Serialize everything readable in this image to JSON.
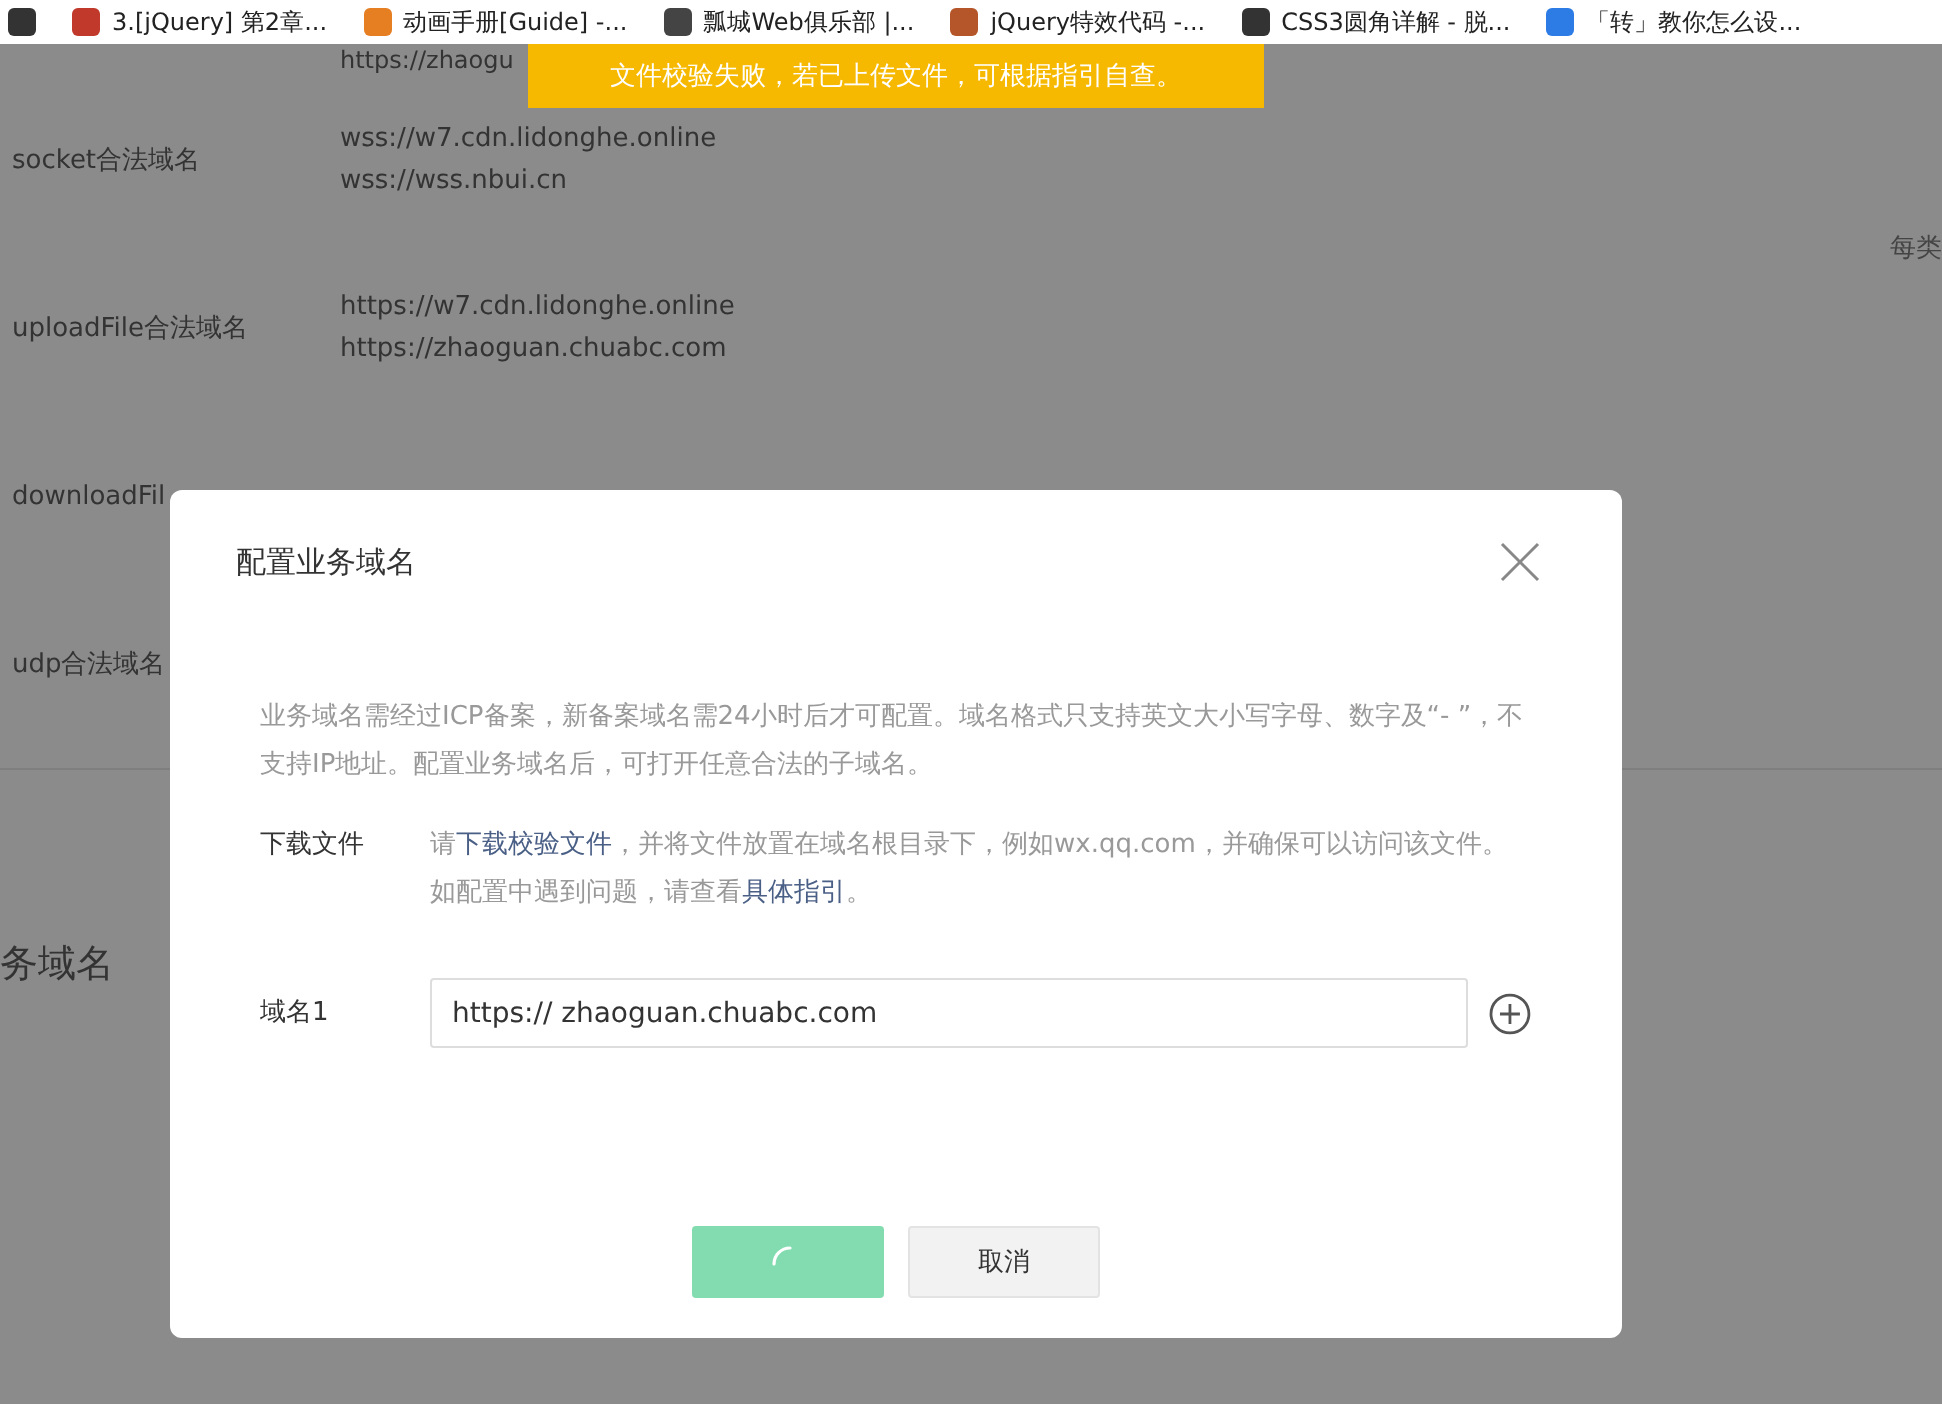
{
  "bookmarks": [
    {
      "kind": "icon"
    },
    {
      "kind": "link",
      "label": "3.[jQuery] 第2章..."
    },
    {
      "kind": "link",
      "label": "动画手册[Guide] -..."
    },
    {
      "kind": "link",
      "label": "瓢城Web俱乐部 |..."
    },
    {
      "kind": "link",
      "label": "jQuery特效代码 -..."
    },
    {
      "kind": "link",
      "label": "CSS3圆角详解 - 脱..."
    },
    {
      "kind": "link",
      "label": "「转」教你怎么设..."
    }
  ],
  "toast": {
    "text": "文件校验失败，若已上传文件，可根据指引自查。"
  },
  "page": {
    "top_value": "https://zhaogu",
    "rows": [
      {
        "label": "socket合法域名",
        "values": [
          "wss://w7.cdn.lidonghe.online",
          "wss://wss.nbui.cn"
        ]
      },
      {
        "label": "uploadFile合法域名",
        "values": [
          "https://w7.cdn.lidonghe.online",
          "https://zhaoguan.chuabc.com"
        ]
      },
      {
        "label": "downloadFil",
        "values": []
      },
      {
        "label": "udp合法域名",
        "values": []
      }
    ],
    "side_note": "每类",
    "section_title": "务域名"
  },
  "dialog": {
    "title": "配置业务域名",
    "description": "业务域名需经过ICP备案，新备案域名需24小时后才可配置。域名格式只支持英文大小写字母、数字及“- ”，不支持IP地址。配置业务域名后，可打开任意合法的子域名。",
    "download_label": "下载文件",
    "download_parts": [
      {
        "kind": "text",
        "text": "请"
      },
      {
        "kind": "link",
        "text": "下载校验文件"
      },
      {
        "kind": "text",
        "text": "，并将文件放置在域名根目录下，例如wx.qq.com，并确保可以访问该文件。如配置中遇到问题，请查看"
      },
      {
        "kind": "link",
        "text": "具体指引"
      },
      {
        "kind": "text",
        "text": "。"
      }
    ],
    "domain_label": "域名1",
    "domain_value": "https:// zhaoguan.chuabc.com",
    "confirm_loading": true,
    "cancel": "取消"
  }
}
